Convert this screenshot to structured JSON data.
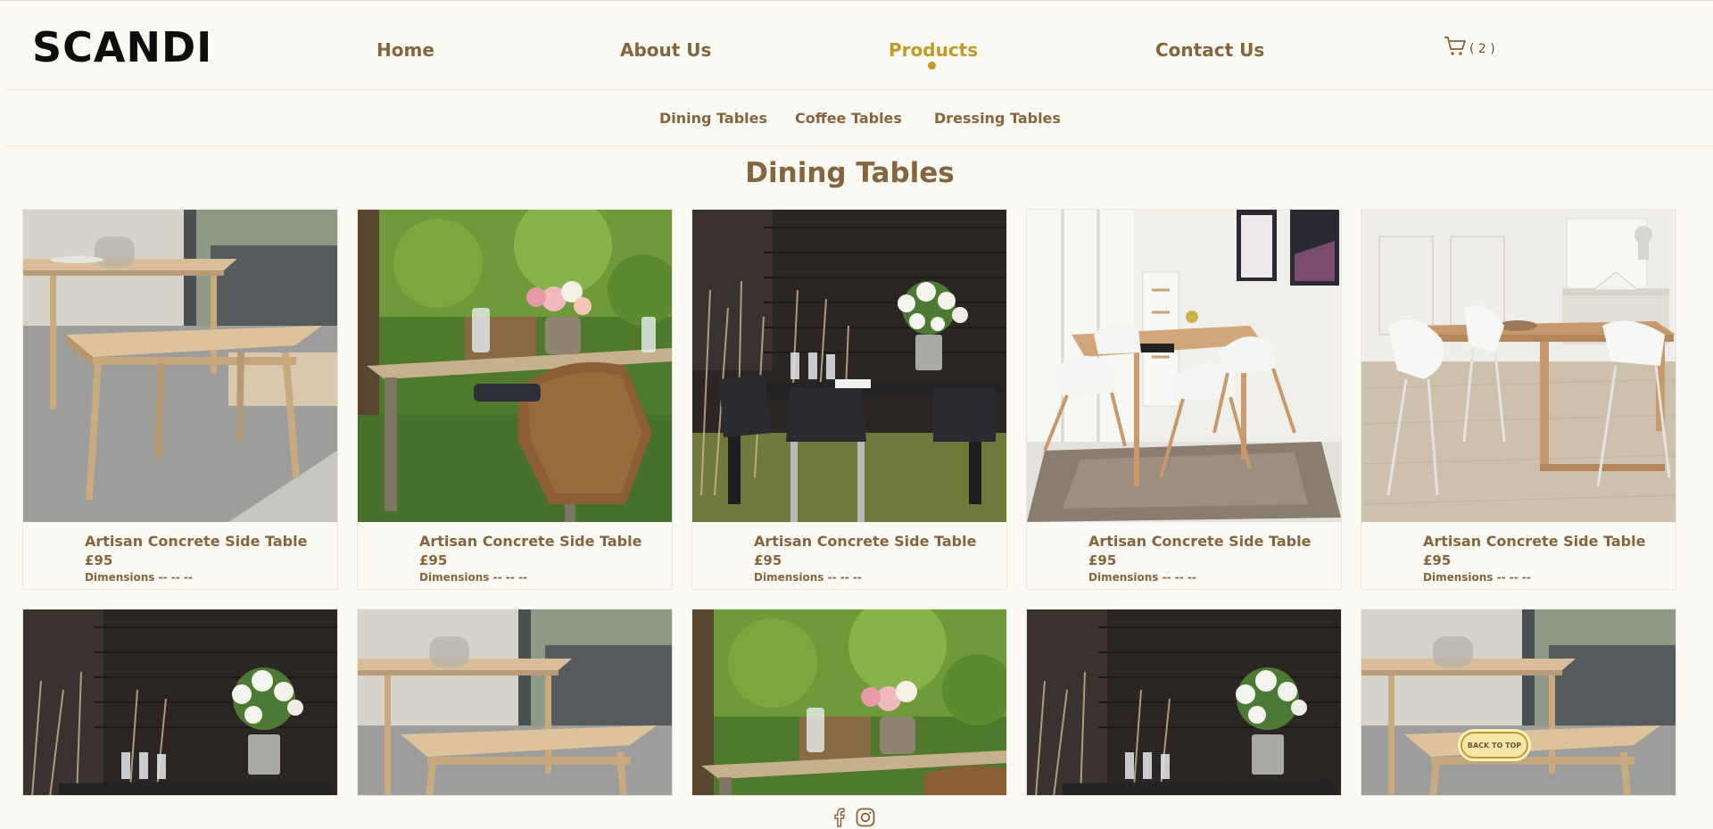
{
  "brand": {
    "logo": "SCANDI"
  },
  "nav": {
    "items": [
      {
        "label": "Home"
      },
      {
        "label": "About Us"
      },
      {
        "label": "Products",
        "active": true
      },
      {
        "label": "Contact Us"
      }
    ],
    "cart": {
      "icon": "shopping-cart-icon",
      "count": "( 2 )"
    }
  },
  "subnav": {
    "items": [
      {
        "label": "Dining Tables"
      },
      {
        "label": "Coffee Tables"
      },
      {
        "label": "Dressing Tables"
      }
    ]
  },
  "main": {
    "title": "Dining Tables",
    "products": [
      {
        "name": "Artisan Concrete Side Table",
        "price": "£95",
        "dims": "Dimensions -- -- --",
        "image": "bench-table"
      },
      {
        "name": "Artisan Concrete Side Table",
        "price": "£95",
        "dims": "Dimensions -- -- --",
        "image": "garden-table"
      },
      {
        "name": "Artisan Concrete Side Table",
        "price": "£95",
        "dims": "Dimensions -- -- --",
        "image": "black-rattan-table"
      },
      {
        "name": "Artisan Concrete Side Table",
        "price": "£95",
        "dims": "Dimensions -- -- --",
        "image": "white-chairs-rug"
      },
      {
        "name": "Artisan Concrete Side Table",
        "price": "£95",
        "dims": "Dimensions -- -- --",
        "image": "white-chairs-room"
      },
      {
        "image": "black-rattan-table"
      },
      {
        "image": "bench-table"
      },
      {
        "image": "garden-table"
      },
      {
        "image": "black-rattan-table"
      },
      {
        "image": "bench-table"
      }
    ]
  },
  "back_to_top": "BACK TO TOP",
  "footer": {
    "icons": [
      "facebook-icon",
      "instagram-icon"
    ]
  },
  "colors": {
    "brown": "#86643d",
    "gold": "#c29a26",
    "background": "#fbfaf5"
  }
}
